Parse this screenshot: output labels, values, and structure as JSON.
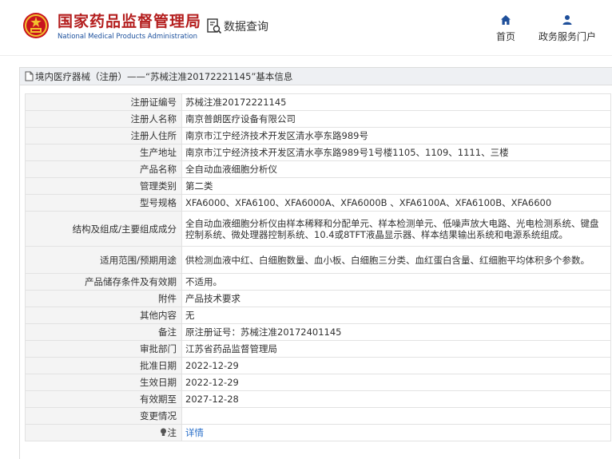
{
  "header": {
    "brand_cn": "国家药品监督管理局",
    "brand_en": "National Medical Products Administration",
    "query_label": "数据查询",
    "nav": [
      {
        "label": "首页",
        "icon": "home-icon"
      },
      {
        "label": "政务服务门户",
        "icon": "user-icon"
      }
    ]
  },
  "breadcrumb": "境内医疗器械（注册）——“苏械注准20172221145”基本信息",
  "rows": [
    {
      "key": "注册证编号",
      "value": "苏械注准20172221145"
    },
    {
      "key": "注册人名称",
      "value": "南京普朗医疗设备有限公司"
    },
    {
      "key": "注册人住所",
      "value": "南京市江宁经济技术开发区清水亭东路989号"
    },
    {
      "key": "生产地址",
      "value": "南京市江宁经济技术开发区清水亭东路989号1号楼1105、1109、1111、三楼"
    },
    {
      "key": "产品名称",
      "value": "全自动血液细胞分析仪"
    },
    {
      "key": "管理类别",
      "value": "第二类"
    },
    {
      "key": "型号规格",
      "value": "XFA6000、XFA6100、XFA6000A、XFA6000B 、XFA6100A、XFA6100B、XFA6600"
    },
    {
      "key": "结构及组成/主要组成成分",
      "value": "全自动血液细胞分析仪由样本稀释和分配单元、样本检测单元、低噪声放大电路、光电检测系统、键盘控制系统、微处理器控制系统、10.4或8TFT液晶显示器、样本结果输出系统和电源系统组成。"
    },
    {
      "key": "适用范围/预期用途",
      "value": "供检测血液中红、白细胞数量、血小板、白细胞三分类、血红蛋白含量、红细胞平均体积多个参数。"
    },
    {
      "key": "产品储存条件及有效期",
      "value": "不适用。"
    },
    {
      "key": "附件",
      "value": "产品技术要求"
    },
    {
      "key": "其他内容",
      "value": "无"
    },
    {
      "key": "备注",
      "value": "原注册证号：苏械注准20172401145"
    },
    {
      "key": "审批部门",
      "value": "江苏省药品监督管理局"
    },
    {
      "key": "批准日期",
      "value": "2022-12-29"
    },
    {
      "key": "生效日期",
      "value": "2022-12-29"
    },
    {
      "key": "有效期至",
      "value": "2027-12-28"
    },
    {
      "key": "变更情况",
      "value": ""
    }
  ],
  "note": {
    "key": "注",
    "link": "详情"
  },
  "colors": {
    "brand_red": "#b41e1e",
    "brand_blue": "#1a4f9c",
    "link": "#2a6fc9",
    "key_bg": "#f4f4f4"
  }
}
